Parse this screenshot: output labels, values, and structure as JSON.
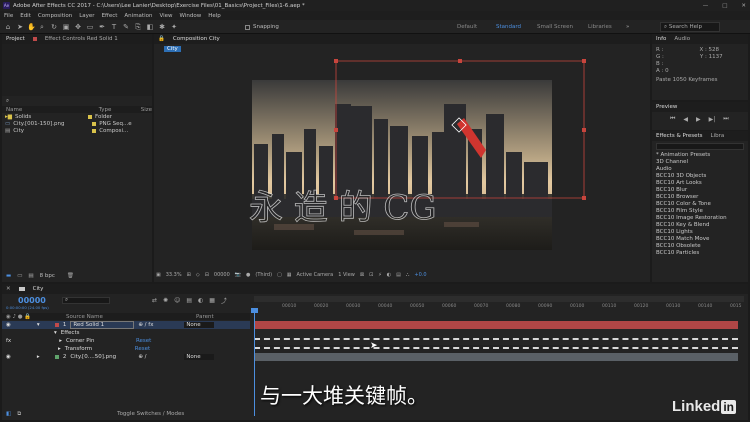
{
  "titlebar": {
    "logo": "Ae",
    "title": "Adobe After Effects CC 2017 - C:\\Users\\Lee Lanier\\Desktop\\Exercise Files\\01_Basics\\Project_Files\\1-6.aep *",
    "min": "—",
    "max": "□",
    "close": "✕"
  },
  "menu": [
    "File",
    "Edit",
    "Composition",
    "Layer",
    "Effect",
    "Animation",
    "View",
    "Window",
    "Help"
  ],
  "toolbar": {
    "snapping": "Snapping",
    "workspaces": [
      "Default",
      "Standard",
      "Small Screen",
      "Libraries"
    ],
    "active_workspace": "Standard",
    "search_placeholder": "Search Help"
  },
  "project": {
    "tab_project": "Project",
    "tab_effects": "Effect Controls Red Solid 1",
    "search_icon": "search",
    "columns": [
      "Name",
      "Type",
      "Size"
    ],
    "items": [
      {
        "name": "Solids",
        "type": "Folder",
        "color": "#d9c24a"
      },
      {
        "name": "City.[001-150].png",
        "type": "PNG Seq...e",
        "color": "#d9c24a"
      },
      {
        "name": "City",
        "type": "Composi...",
        "color": "#d9c24a"
      }
    ],
    "bpc": "8 bpc"
  },
  "comp": {
    "tab": "Composition City",
    "comp_name_tag": "City",
    "watermark": "永 造 的 CG",
    "zoom": "33.3%",
    "timecode": "00000",
    "resolution": "(Third)",
    "camera": "Active Camera",
    "views": "1 View",
    "exposure": "+0.0"
  },
  "info": {
    "tab_info": "Info",
    "tab_audio": "Audio",
    "r": "R :",
    "g": "G :",
    "b": "B :",
    "a": "A : 0",
    "x": "X : 528",
    "y": "Y : 1137",
    "status": "Paste 1050 Keyframes"
  },
  "preview": {
    "tab": "Preview"
  },
  "effects": {
    "tab": "Effects & Presets",
    "tab2": "Libra",
    "items": [
      "* Animation Presets",
      "3D Channel",
      "Audio",
      "BCC10 3D Objects",
      "BCC10 Art Looks",
      "BCC10 Blur",
      "BCC10 Browser",
      "BCC10 Color & Tone",
      "BCC10 Film Style",
      "BCC10 Image Restoration",
      "BCC10 Key & Blend",
      "BCC10 Lights",
      "BCC10 Match Move",
      "BCC10 Obsolete",
      "BCC10 Particles"
    ]
  },
  "timeline": {
    "tab": "City",
    "timecode": "00000",
    "subtime": "0:00:00:00 (24.00 fps)",
    "col_source": "Source Name",
    "col_parent": "Parent",
    "ticks": [
      "00010",
      "00020",
      "00030",
      "00040",
      "00050",
      "00060",
      "00070",
      "00080",
      "00090",
      "00100",
      "00110",
      "00120",
      "00130",
      "00140",
      "0015"
    ],
    "layers": [
      {
        "num": "1",
        "name": "Red Solid 1",
        "parent": "None",
        "color": "#c04a4a"
      },
      {
        "num": "",
        "name": "Effects",
        "parent": "",
        "color": ""
      },
      {
        "num": "",
        "name": "Corner Pin",
        "parent": "Reset",
        "color": ""
      },
      {
        "num": "",
        "name": "Transform",
        "parent": "Reset",
        "color": ""
      },
      {
        "num": "2",
        "name": "City.[0....50].png",
        "parent": "None",
        "color": "#5fa36b"
      }
    ],
    "toggle": "Toggle Switches / Modes"
  },
  "subtitle": "与一大堆关键帧。",
  "linkedin": "Linked",
  "linkedin_in": "in",
  "colors": {
    "accent": "#4c8fe0",
    "red_bar": "#b04646",
    "gray_bar": "#5a6066"
  }
}
